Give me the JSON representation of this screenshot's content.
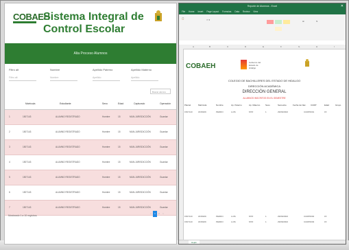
{
  "left_app": {
    "logo": "COBAEH",
    "title": "Sistema Integral de Control Escolar",
    "banner": "Alta Proceso Alumnos",
    "filters": [
      {
        "label": "Filtro alt",
        "placeholder": "Filtro alt"
      },
      {
        "label": "Nombre",
        "placeholder": "Nombre"
      },
      {
        "label": "Apellido Paterno",
        "placeholder": "Apellido"
      },
      {
        "label": "Apellido Materno",
        "placeholder": "Apellido"
      }
    ],
    "search_placeholder": "Buscar alumno",
    "table": {
      "headers": [
        "Matrícula",
        "Estudiante",
        "Sexo",
        "Edad",
        "Capturado",
        "Operación"
      ],
      "rows": [
        {
          "num": "1",
          "id": "1507143",
          "name": "ALUMNO REGISTRADO",
          "sex": "Hombre",
          "age": "15",
          "grp": "MUN.JURISDICCIÓN",
          "op": "Guardar"
        },
        {
          "num": "2",
          "id": "1507143",
          "name": "ALUMNO REGISTRADO",
          "sex": "Hombre",
          "age": "15",
          "grp": "MUN.JURISDICCIÓN",
          "op": "Guardar"
        },
        {
          "num": "3",
          "id": "1507143",
          "name": "ALUMNO REGISTRADO",
          "sex": "Hombre",
          "age": "15",
          "grp": "MUN.JURISDICCIÓN",
          "op": "Guardar"
        },
        {
          "num": "4",
          "id": "1507143",
          "name": "ALUMNO REGISTRADO",
          "sex": "Hombre",
          "age": "15",
          "grp": "MUN.JURISDICCIÓN",
          "op": "Guardar"
        },
        {
          "num": "5",
          "id": "1507143",
          "name": "ALUMNO REGISTRADO",
          "sex": "Hombre",
          "age": "15",
          "grp": "MUN.JURISDICCIÓN",
          "op": "Guardar"
        },
        {
          "num": "6",
          "id": "1507143",
          "name": "ALUMNO REGISTRADO",
          "sex": "Hombre",
          "age": "15",
          "grp": "MUN.JURISDICCIÓN",
          "op": "Guardar"
        },
        {
          "num": "7",
          "id": "1507143",
          "name": "ALUMNO REGISTRADO",
          "sex": "Hombre",
          "age": "15",
          "grp": "MUN.JURISDICCIÓN",
          "op": "Guardar"
        }
      ]
    },
    "footer": "Mostrando 1 a 10 registros",
    "pager": [
      "<",
      "1",
      "2",
      ">"
    ]
  },
  "excel": {
    "title": "Reporte de Alumnos - Excel",
    "menu": [
      "File",
      "Home",
      "Insert",
      "Page Layout",
      "Formulas",
      "Data",
      "Review",
      "View"
    ],
    "logo": "COBAEH",
    "state_line1": "Gobierno del",
    "state_line2": "Estado de",
    "state_line3": "Hidalgo",
    "report_lines": [
      "COLEGIO DE BACHILLERES DEL ESTADO DE HIDALGO",
      "DIRECCIÓN ACADÉMICA",
      "DIRECCIÓN GENERAL"
    ],
    "report_sub": "ALUMNOS INSCRITOS EN EL SEMESTRE",
    "headers": [
      "Plantel",
      "Matrícula",
      "Nombre",
      "Ap. Paterno",
      "Ap. Materno",
      "Sexo",
      "Semestre",
      "Fecha de Nac.",
      "CURP",
      "Edad",
      "Grupo"
    ],
    "rows": [
      {
        "a": "1507143",
        "b": "1815209",
        "c": "PEDRO",
        "d": "LUIS",
        "e": "MTZ",
        "f": "1",
        "g": "29/06/2002",
        "h": "CURP0001",
        "i": "15"
      },
      {
        "a": "1507143",
        "b": "1815209",
        "c": "PEDRO",
        "d": "LUIS",
        "e": "MTZ",
        "f": "1",
        "g": "29/06/2002",
        "h": "CURP0002",
        "i": "15"
      },
      {
        "a": "1507143",
        "b": "1815209",
        "c": "PEDRO",
        "d": "LUIS",
        "e": "MTZ",
        "f": "1",
        "g": "29/06/2002",
        "h": "CURP0003",
        "i": "15"
      }
    ],
    "sheet_tab": "Hoja1"
  }
}
